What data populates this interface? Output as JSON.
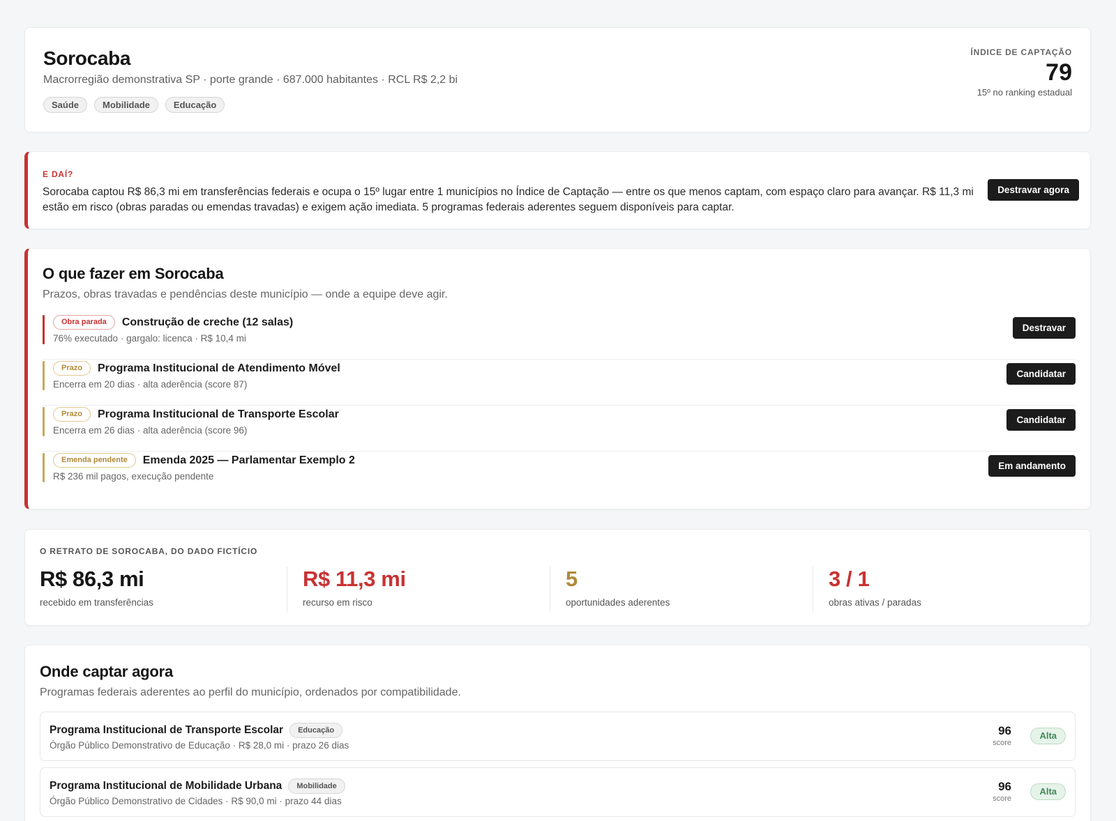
{
  "header": {
    "title": "Sorocaba",
    "subtitle": "Macrorregião demonstrativa SP · porte grande · 687.000 habitantes · RCL R$ 2,2 bi",
    "tags": [
      "Saúde",
      "Mobilidade",
      "Educação"
    ],
    "index_label": "ÍNDICE DE CAPTAÇÃO",
    "index_value": "79",
    "index_rank": "15º no ranking estadual"
  },
  "insight": {
    "kicker": "E DAÍ?",
    "text": "Sorocaba captou R$ 86,3 mi em transferências federais e ocupa o 15º lugar entre 1 municípios no Índice de Captação — entre os que menos captam, com espaço claro para avançar. R$ 11,3 mi estão em risco (obras paradas ou emendas travadas) e exigem ação imediata. 5 programas federais aderentes seguem disponíveis para captar.",
    "button": "Destravar agora",
    "accent": "#c93232"
  },
  "todo": {
    "title": "O que fazer em Sorocaba",
    "subtitle": "Prazos, obras travadas e pendências deste município — onde a equipe deve agir.",
    "items": [
      {
        "badge": "Obra parada",
        "tone": "red",
        "title": "Construção de creche (12 salas)",
        "meta": "76% executado · gargalo: licenca · R$ 10,4 mi",
        "action": "Destravar"
      },
      {
        "badge": "Prazo",
        "tone": "gold",
        "title": "Programa Institucional de Atendimento Móvel",
        "meta": "Encerra em 20 dias · alta aderência (score 87)",
        "action": "Candidatar"
      },
      {
        "badge": "Prazo",
        "tone": "gold",
        "title": "Programa Institucional de Transporte Escolar",
        "meta": "Encerra em 26 dias · alta aderência (score 96)",
        "action": "Candidatar"
      },
      {
        "badge": "Emenda pendente",
        "tone": "gold",
        "title": "Emenda 2025 — Parlamentar Exemplo 2",
        "meta": "R$ 236 mil pagos, execução pendente",
        "action": "Em andamento"
      }
    ],
    "colors": {
      "red": "#c93232",
      "gold": "#b08a3a"
    }
  },
  "stats": {
    "kicker": "O RETRATO DE SOROCABA, DO DADO FICTÍCIO",
    "items": [
      {
        "value": "R$ 86,3 mi",
        "label": "recebido em transferências",
        "color": "#161616"
      },
      {
        "value": "R$ 11,3 mi",
        "label": "recurso em risco",
        "color": "#c93232"
      },
      {
        "value": "5",
        "label": "oportunidades aderentes",
        "color": "#b08a3a"
      },
      {
        "value": "3 / 1",
        "label": "obras ativas / paradas",
        "color": "#c93232"
      }
    ]
  },
  "captar": {
    "title": "Onde captar agora",
    "subtitle": "Programas federais aderentes ao perfil do município, ordenados por compatibilidade.",
    "programs": [
      {
        "title": "Programa Institucional de Transporte Escolar",
        "tag": "Educação",
        "meta": "Órgão Público Demonstrativo de Educação · R$ 28,0 mi · prazo 26 dias",
        "score": "96",
        "score_label": "score",
        "level": "Alta"
      },
      {
        "title": "Programa Institucional de Mobilidade Urbana",
        "tag": "Mobilidade",
        "meta": "Órgão Público Demonstrativo de Cidades · R$ 90,0 mi · prazo 44 dias",
        "score": "96",
        "score_label": "score",
        "level": "Alta"
      }
    ]
  }
}
